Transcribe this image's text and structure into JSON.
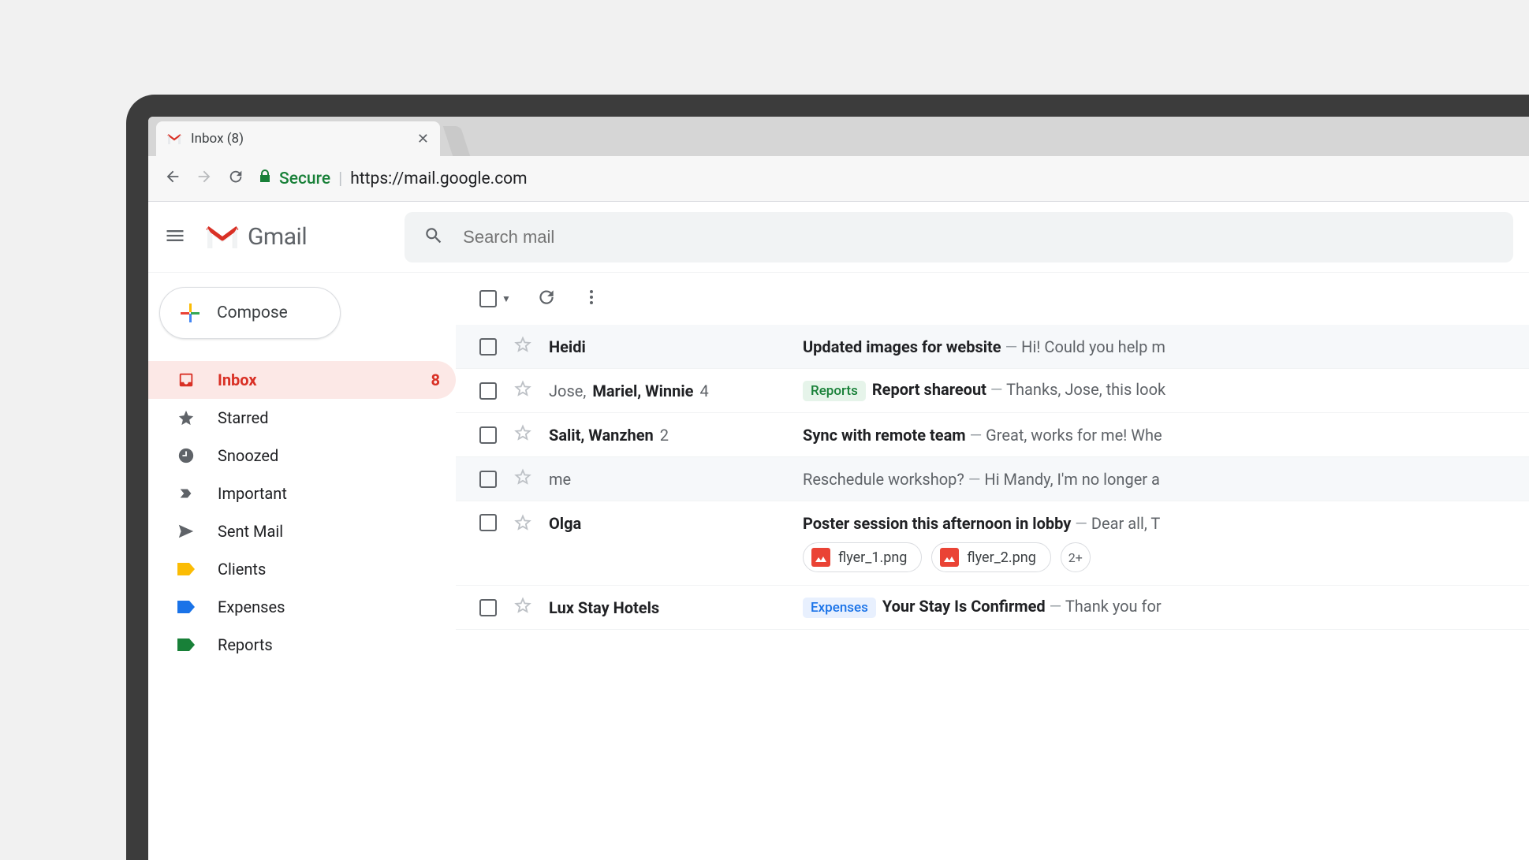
{
  "browser": {
    "tab_title": "Inbox (8)",
    "secure_label": "Secure",
    "url": "https://mail.google.com"
  },
  "header": {
    "brand": "Gmail",
    "search_placeholder": "Search mail"
  },
  "compose_label": "Compose",
  "nav": [
    {
      "label": "Inbox",
      "count": "8",
      "kind": "inbox",
      "active": true
    },
    {
      "label": "Starred",
      "kind": "star"
    },
    {
      "label": "Snoozed",
      "kind": "clock"
    },
    {
      "label": "Important",
      "kind": "important"
    },
    {
      "label": "Sent Mail",
      "kind": "sent"
    },
    {
      "label": "Clients",
      "kind": "label",
      "color": "#fbbc04"
    },
    {
      "label": "Expenses",
      "kind": "label",
      "color": "#1a73e8"
    },
    {
      "label": "Reports",
      "kind": "label",
      "color": "#188038"
    }
  ],
  "emails": [
    {
      "sender_parts": [
        {
          "text": "Heidi",
          "bold": true
        }
      ],
      "subject": "Updated images for website",
      "subject_bold": true,
      "snippet": "Hi! Could you help m",
      "shade": true
    },
    {
      "sender_parts": [
        {
          "text": "Jose, ",
          "bold": false
        },
        {
          "text": "Mariel, Winnie",
          "bold": true
        }
      ],
      "thread_count": "4",
      "tag": {
        "text": "Reports",
        "bg": "#e6f4ea",
        "fg": "#188038"
      },
      "subject": "Report shareout",
      "subject_bold": true,
      "snippet": "Thanks, Jose, this look"
    },
    {
      "sender_parts": [
        {
          "text": "Salit, Wanzhen",
          "bold": true
        }
      ],
      "thread_count": "2",
      "subject": "Sync with remote team",
      "subject_bold": true,
      "snippet": "Great, works for me! Whe"
    },
    {
      "sender_parts": [
        {
          "text": "me",
          "bold": false
        }
      ],
      "subject": "Reschedule workshop?",
      "subject_bold": false,
      "snippet": "Hi Mandy, I'm no longer a",
      "shade": true
    },
    {
      "sender_parts": [
        {
          "text": "Olga",
          "bold": true
        }
      ],
      "subject": "Poster session this afternoon in lobby",
      "subject_bold": true,
      "snippet": "Dear all, T",
      "attachments": [
        "flyer_1.png",
        "flyer_2.png"
      ],
      "more_attach": "2+"
    },
    {
      "sender_parts": [
        {
          "text": "Lux Stay Hotels",
          "bold": true
        }
      ],
      "tag": {
        "text": "Expenses",
        "bg": "#e8f0fe",
        "fg": "#1a73e8"
      },
      "subject": "Your Stay Is Confirmed",
      "subject_bold": true,
      "snippet": "Thank you for"
    }
  ],
  "sep": "—"
}
